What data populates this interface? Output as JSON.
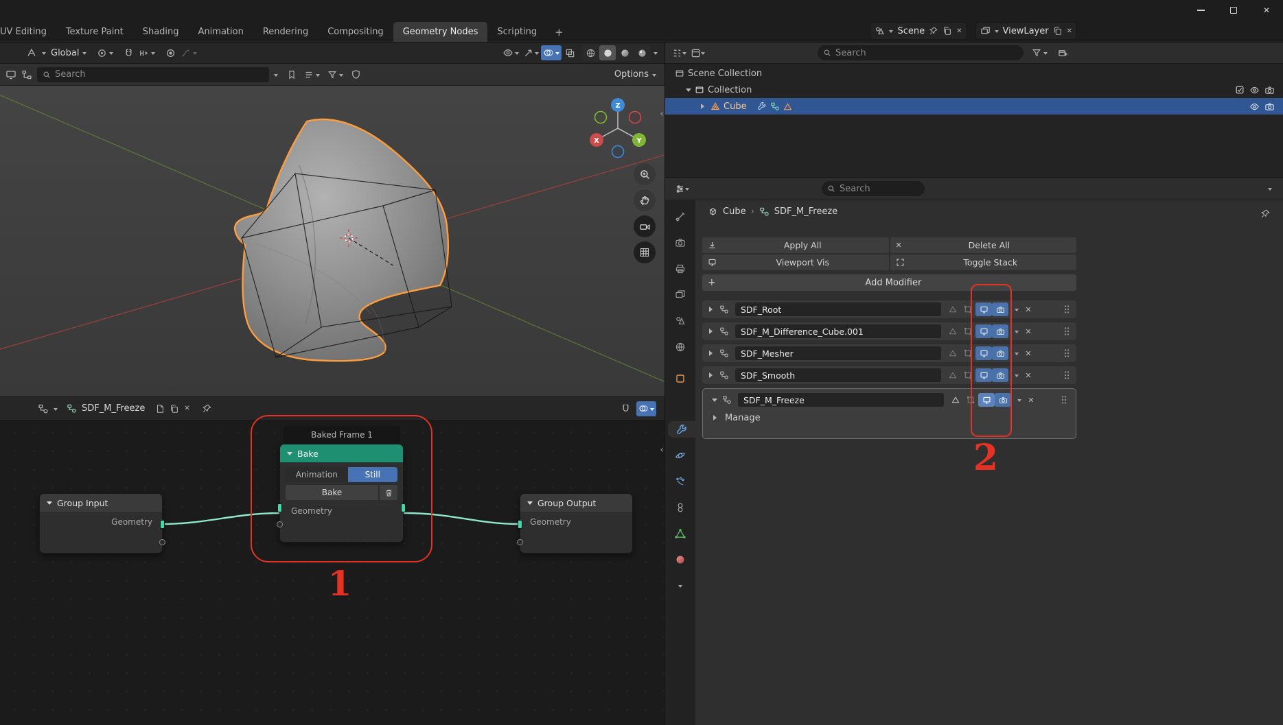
{
  "glyphs": {
    "close": "✕",
    "plus": "+",
    "panel_arrow": "‹",
    "breadcrumb_sep": "›"
  },
  "topbar": {
    "tabs": [
      {
        "label": "UV Editing"
      },
      {
        "label": "Texture Paint"
      },
      {
        "label": "Shading"
      },
      {
        "label": "Animation"
      },
      {
        "label": "Rendering"
      },
      {
        "label": "Compositing"
      },
      {
        "label": "Geometry Nodes"
      },
      {
        "label": "Scripting"
      }
    ],
    "active_tab": "Geometry Nodes",
    "scene_selector": {
      "label": "Scene"
    },
    "viewlayer_selector": {
      "label": "ViewLayer"
    }
  },
  "viewport": {
    "header": {
      "orientation": "Global",
      "search_placeholder": "Search",
      "options_label": "Options"
    },
    "gizmo": {
      "x_label": "X",
      "y_label": "Y",
      "z_label": "Z"
    }
  },
  "node_editor": {
    "header": {
      "tree_name": "SDF_M_Freeze"
    },
    "group_input": {
      "title": "Group Input",
      "output_label": "Geometry"
    },
    "bake": {
      "overlay_label": "Baked Frame 1",
      "title": "Bake",
      "mode_animation": "Animation",
      "mode_still": "Still",
      "bake_button": "Bake",
      "socket_label": "Geometry"
    },
    "group_output": {
      "title": "Group Output",
      "input_label": "Geometry"
    }
  },
  "outliner": {
    "search_placeholder": "Search",
    "rows": [
      {
        "label": "Scene Collection"
      },
      {
        "label": "Collection"
      },
      {
        "label": "Cube"
      }
    ]
  },
  "properties": {
    "search_placeholder": "Search",
    "breadcrumb": {
      "object_label": "Cube",
      "modifier_label": "SDF_M_Freeze"
    },
    "actions": {
      "apply_all": "Apply All",
      "delete_all": "Delete All",
      "viewport_vis": "Viewport Vis",
      "toggle_stack": "Toggle Stack",
      "add_modifier": "Add Modifier"
    },
    "modifiers": [
      {
        "name": "SDF_Root"
      },
      {
        "name": "SDF_M_Difference_Cube.001"
      },
      {
        "name": "SDF_Mesher"
      },
      {
        "name": "SDF_Smooth"
      },
      {
        "name": "SDF_M_Freeze"
      }
    ],
    "manage_label": "Manage"
  },
  "annotations": {
    "node_bake": "1",
    "modifier_toggles": "2"
  },
  "colors": {
    "accent_blue": "#4772b3",
    "select_blue": "#315694",
    "object_orange": "#ff9e3d",
    "bake_header_teal": "#1f8f72",
    "wire_mint": "#8fe8cc",
    "annotation_red": "#e53222"
  }
}
